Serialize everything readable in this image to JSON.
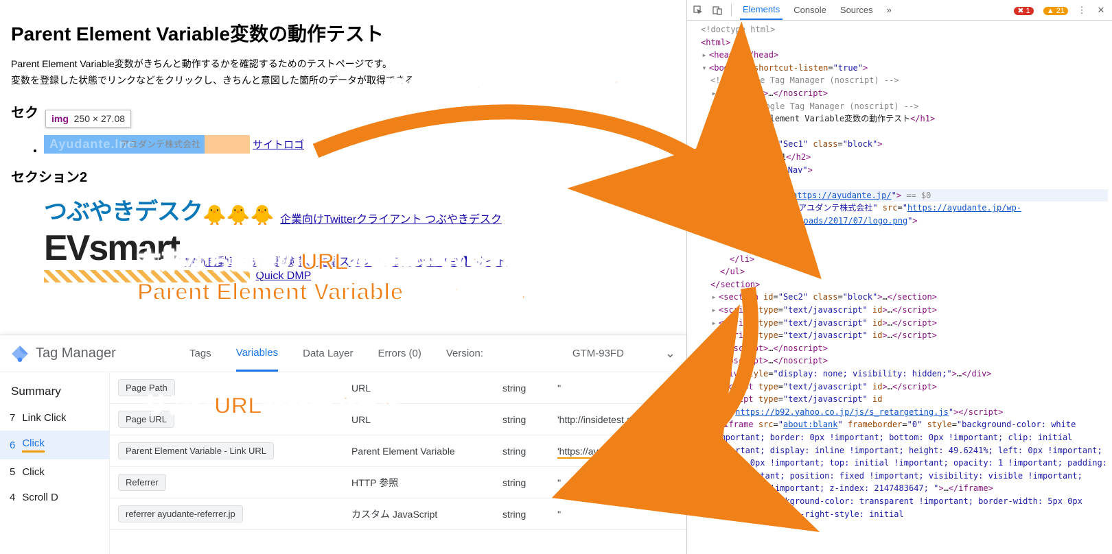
{
  "page": {
    "title": "Parent Element Variable変数の動作テスト",
    "desc1": "Parent Element Variable変数がきちんと動作するかを確認するためのテストページです。",
    "desc2": "変数を登録した状態でリンクなどをクリックし、きちんと意図した箇所のデータが取得できる",
    "sec1": "セクション1 ▸",
    "sec2": "セクション2",
    "tooltip_tag": "img",
    "tooltip_dim": "250 × 27.08",
    "logo_jp": "アユダンテ株式会社",
    "logo_faint": "Ayudante.Inc",
    "sitelogo_link": "サイトロゴ",
    "link2": "企業向けTwitterクライアント つぶやきデスク",
    "link3": "電気自動車の充電器検索、充電スタンド・スポット【EV】サイト",
    "link4": "Quick DMP",
    "tsubuyaki": "つぶやきデスク",
    "evsmart": "EVsmart"
  },
  "anno": {
    "a1": "画像部分をクリックしても",
    "a2a": "本来なら画像のURLが取得されるけど",
    "a2b": "Parent Element Variable変数を使えば",
    "a3": "リンクURLが取得できる"
  },
  "gtm": {
    "brand": "Tag Manager",
    "tabs": [
      "Tags",
      "Variables",
      "Data Layer",
      "Errors (0)",
      "Version:"
    ],
    "active_tab": 1,
    "container": "GTM-93FD",
    "summary": "Summary",
    "events": [
      {
        "n": "7",
        "label": "Link Click"
      },
      {
        "n": "6",
        "label": "Click",
        "active": true
      },
      {
        "n": "5",
        "label": "Click"
      },
      {
        "n": "4",
        "label": "Scroll D"
      }
    ],
    "rows": [
      {
        "name": "Page Path",
        "type": "URL",
        "rt": "string",
        "val": "''"
      },
      {
        "name": "Page URL",
        "type": "URL",
        "rt": "string",
        "val": "'http://insidetest.ayudante…'"
      },
      {
        "name": "Parent Element Variable - Link URL",
        "type": "Parent Element Variable",
        "rt": "string",
        "val": "'https://ayudante.jp/'",
        "hl": true
      },
      {
        "name": "Referrer",
        "type": "HTTP 参照",
        "rt": "string",
        "val": "''"
      },
      {
        "name": "referrer ayudante-referrer.jp",
        "type": "カスタム JavaScript",
        "rt": "string",
        "val": "''"
      }
    ]
  },
  "dt": {
    "tabs": [
      "Elements",
      "Console",
      "Sources"
    ],
    "more": "»",
    "err": "1",
    "warn": "21",
    "a_href": "https://ayudante.jp/",
    "img_alt": "アユダンテ株式会社",
    "img_src": "https://ayudante.jp/wp-content/uploads/2017/07/logo.png",
    "sitelogo_text": "\"サイトロゴ\"",
    "yahoo_src": "https://b92.yahoo.co.jp/js/s_retargeting.js",
    "eq0": " == $0"
  }
}
